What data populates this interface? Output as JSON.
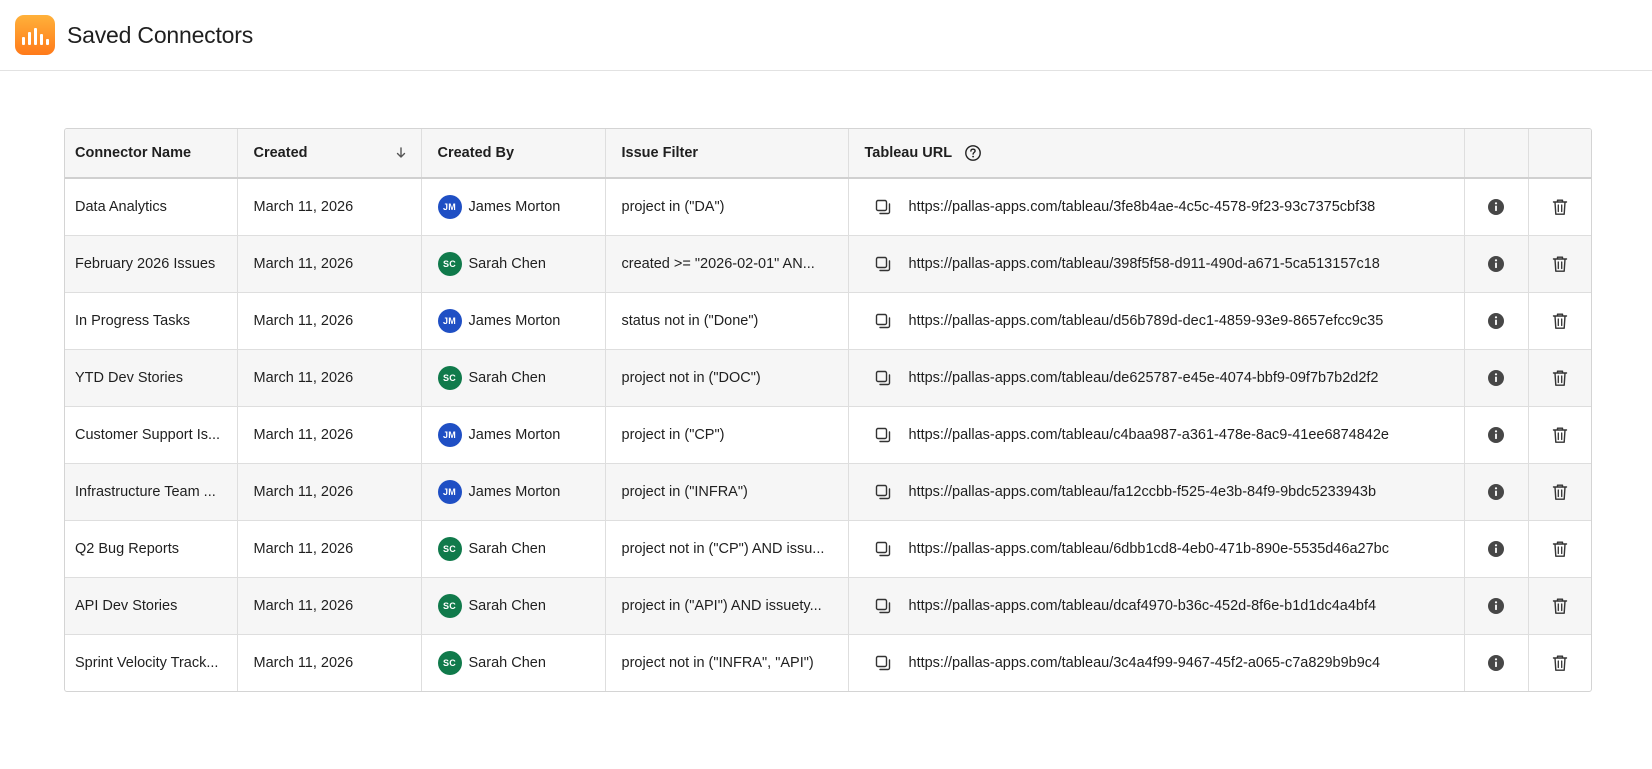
{
  "header": {
    "title": "Saved Connectors",
    "logo_icon": "bar-chart-icon",
    "logo_gradient": [
      "#ffb13a",
      "#ff7a1a"
    ]
  },
  "table": {
    "columns": {
      "name": "Connector Name",
      "created": "Created",
      "created_by": "Created By",
      "issue_filter": "Issue Filter",
      "tableau_url": "Tableau URL"
    },
    "sort": {
      "column": "created",
      "direction": "descending",
      "icon": "arrow-down-icon"
    },
    "avatar_colors": {
      "JM": "#1f4fc4",
      "SC": "#107a4b"
    },
    "rows": [
      {
        "name": "Data Analytics",
        "created": "March 11, 2026",
        "initials": "JM",
        "created_by": "James Morton",
        "filter": "project in (\"DA\")",
        "url": "https://pallas-apps.com/tableau/3fe8b4ae-4c5c-4578-9f23-93c7375cbf38"
      },
      {
        "name": "February 2026 Issues",
        "created": "March 11, 2026",
        "initials": "SC",
        "created_by": "Sarah Chen",
        "filter": "created >= \"2026-02-01\" AN...",
        "url": "https://pallas-apps.com/tableau/398f5f58-d911-490d-a671-5ca513157c18"
      },
      {
        "name": "In Progress Tasks",
        "created": "March 11, 2026",
        "initials": "JM",
        "created_by": "James Morton",
        "filter": "status not in (\"Done\")",
        "url": "https://pallas-apps.com/tableau/d56b789d-dec1-4859-93e9-8657efcc9c35"
      },
      {
        "name": "YTD Dev Stories",
        "created": "March 11, 2026",
        "initials": "SC",
        "created_by": "Sarah Chen",
        "filter": "project not in (\"DOC\")",
        "url": "https://pallas-apps.com/tableau/de625787-e45e-4074-bbf9-09f7b7b2d2f2"
      },
      {
        "name": "Customer Support Is...",
        "created": "March 11, 2026",
        "initials": "JM",
        "created_by": "James Morton",
        "filter": "project in (\"CP\")",
        "url": "https://pallas-apps.com/tableau/c4baa987-a361-478e-8ac9-41ee6874842e"
      },
      {
        "name": "Infrastructure Team ...",
        "created": "March 11, 2026",
        "initials": "JM",
        "created_by": "James Morton",
        "filter": "project in (\"INFRA\")",
        "url": "https://pallas-apps.com/tableau/fa12ccbb-f525-4e3b-84f9-9bdc5233943b"
      },
      {
        "name": "Q2 Bug Reports",
        "created": "March 11, 2026",
        "initials": "SC",
        "created_by": "Sarah Chen",
        "filter": "project not in (\"CP\") AND issu...",
        "url": "https://pallas-apps.com/tableau/6dbb1cd8-4eb0-471b-890e-5535d46a27bc"
      },
      {
        "name": "API Dev Stories",
        "created": "March 11, 2026",
        "initials": "SC",
        "created_by": "Sarah Chen",
        "filter": "project in (\"API\") AND issuety...",
        "url": "https://pallas-apps.com/tableau/dcaf4970-b36c-452d-8f6e-b1d1dc4a4bf4"
      },
      {
        "name": "Sprint Velocity Track...",
        "created": "March 11, 2026",
        "initials": "SC",
        "created_by": "Sarah Chen",
        "filter": "project not in (\"INFRA\", \"API\")",
        "url": "https://pallas-apps.com/tableau/3c4a4f99-9467-45f2-a065-c7a829b9b9c4"
      }
    ],
    "row_icons": {
      "copy": "copy-icon",
      "info": "info-icon",
      "delete": "trash-icon"
    }
  }
}
